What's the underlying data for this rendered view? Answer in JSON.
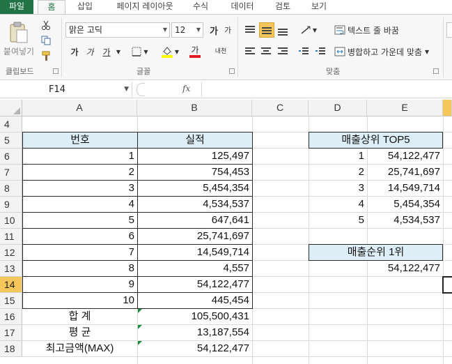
{
  "tabs": [
    "파일",
    "홈",
    "삽입",
    "페이지 레이아웃",
    "수식",
    "데이터",
    "검토",
    "보기"
  ],
  "ribbon": {
    "clipboard": {
      "paste_label": "붙여넣기",
      "group_label": "클립보드"
    },
    "font": {
      "font_name": "맑은 고딕",
      "font_size": "12",
      "bold": "가",
      "italic": "가",
      "underline": "가",
      "grow": "가",
      "shrink": "가",
      "phonetic": "내천",
      "group_label": "글꼴"
    },
    "align": {
      "wrap_text": "텍스트 줄 바꿈",
      "merge_center": "병합하고 가운데 맞춤",
      "group_label": "맞춤"
    }
  },
  "formula_bar": {
    "name_box": "F14",
    "fx": "fx",
    "formula": ""
  },
  "columns": [
    "A",
    "B",
    "C",
    "D",
    "E"
  ],
  "rows": [
    "4",
    "5",
    "6",
    "7",
    "8",
    "9",
    "10",
    "11",
    "12",
    "13",
    "14",
    "15",
    "16",
    "17",
    "18"
  ],
  "selected_row": "14",
  "table1": {
    "header_no": "번호",
    "header_perf": "실적",
    "rows": [
      {
        "no": "1",
        "value": "125,497"
      },
      {
        "no": "2",
        "value": "754,453"
      },
      {
        "no": "3",
        "value": "5,454,354"
      },
      {
        "no": "4",
        "value": "4,534,537"
      },
      {
        "no": "5",
        "value": "647,641"
      },
      {
        "no": "6",
        "value": "25,741,697"
      },
      {
        "no": "7",
        "value": "14,549,714"
      },
      {
        "no": "8",
        "value": "4,557"
      },
      {
        "no": "9",
        "value": "54,122,477"
      },
      {
        "no": "10",
        "value": "445,454"
      }
    ],
    "total_label": "합 계",
    "total_value": "105,500,431",
    "avg_label": "평 균",
    "avg_value": "13,187,554",
    "max_label": "최고금액(MAX)",
    "max_value": "54,122,477"
  },
  "top5": {
    "title": "매출상위 TOP5",
    "rows": [
      {
        "rank": "1",
        "value": "54,122,477"
      },
      {
        "rank": "2",
        "value": "25,741,697"
      },
      {
        "rank": "3",
        "value": "14,549,714"
      },
      {
        "rank": "4",
        "value": "5,454,354"
      },
      {
        "rank": "5",
        "value": "4,534,537"
      }
    ]
  },
  "rank1": {
    "title": "매출순위 1위",
    "value": "54,122,477"
  },
  "colors": {
    "excel_green": "#217346",
    "header_fill": "#deeef6",
    "selection": "#f5c75a"
  }
}
